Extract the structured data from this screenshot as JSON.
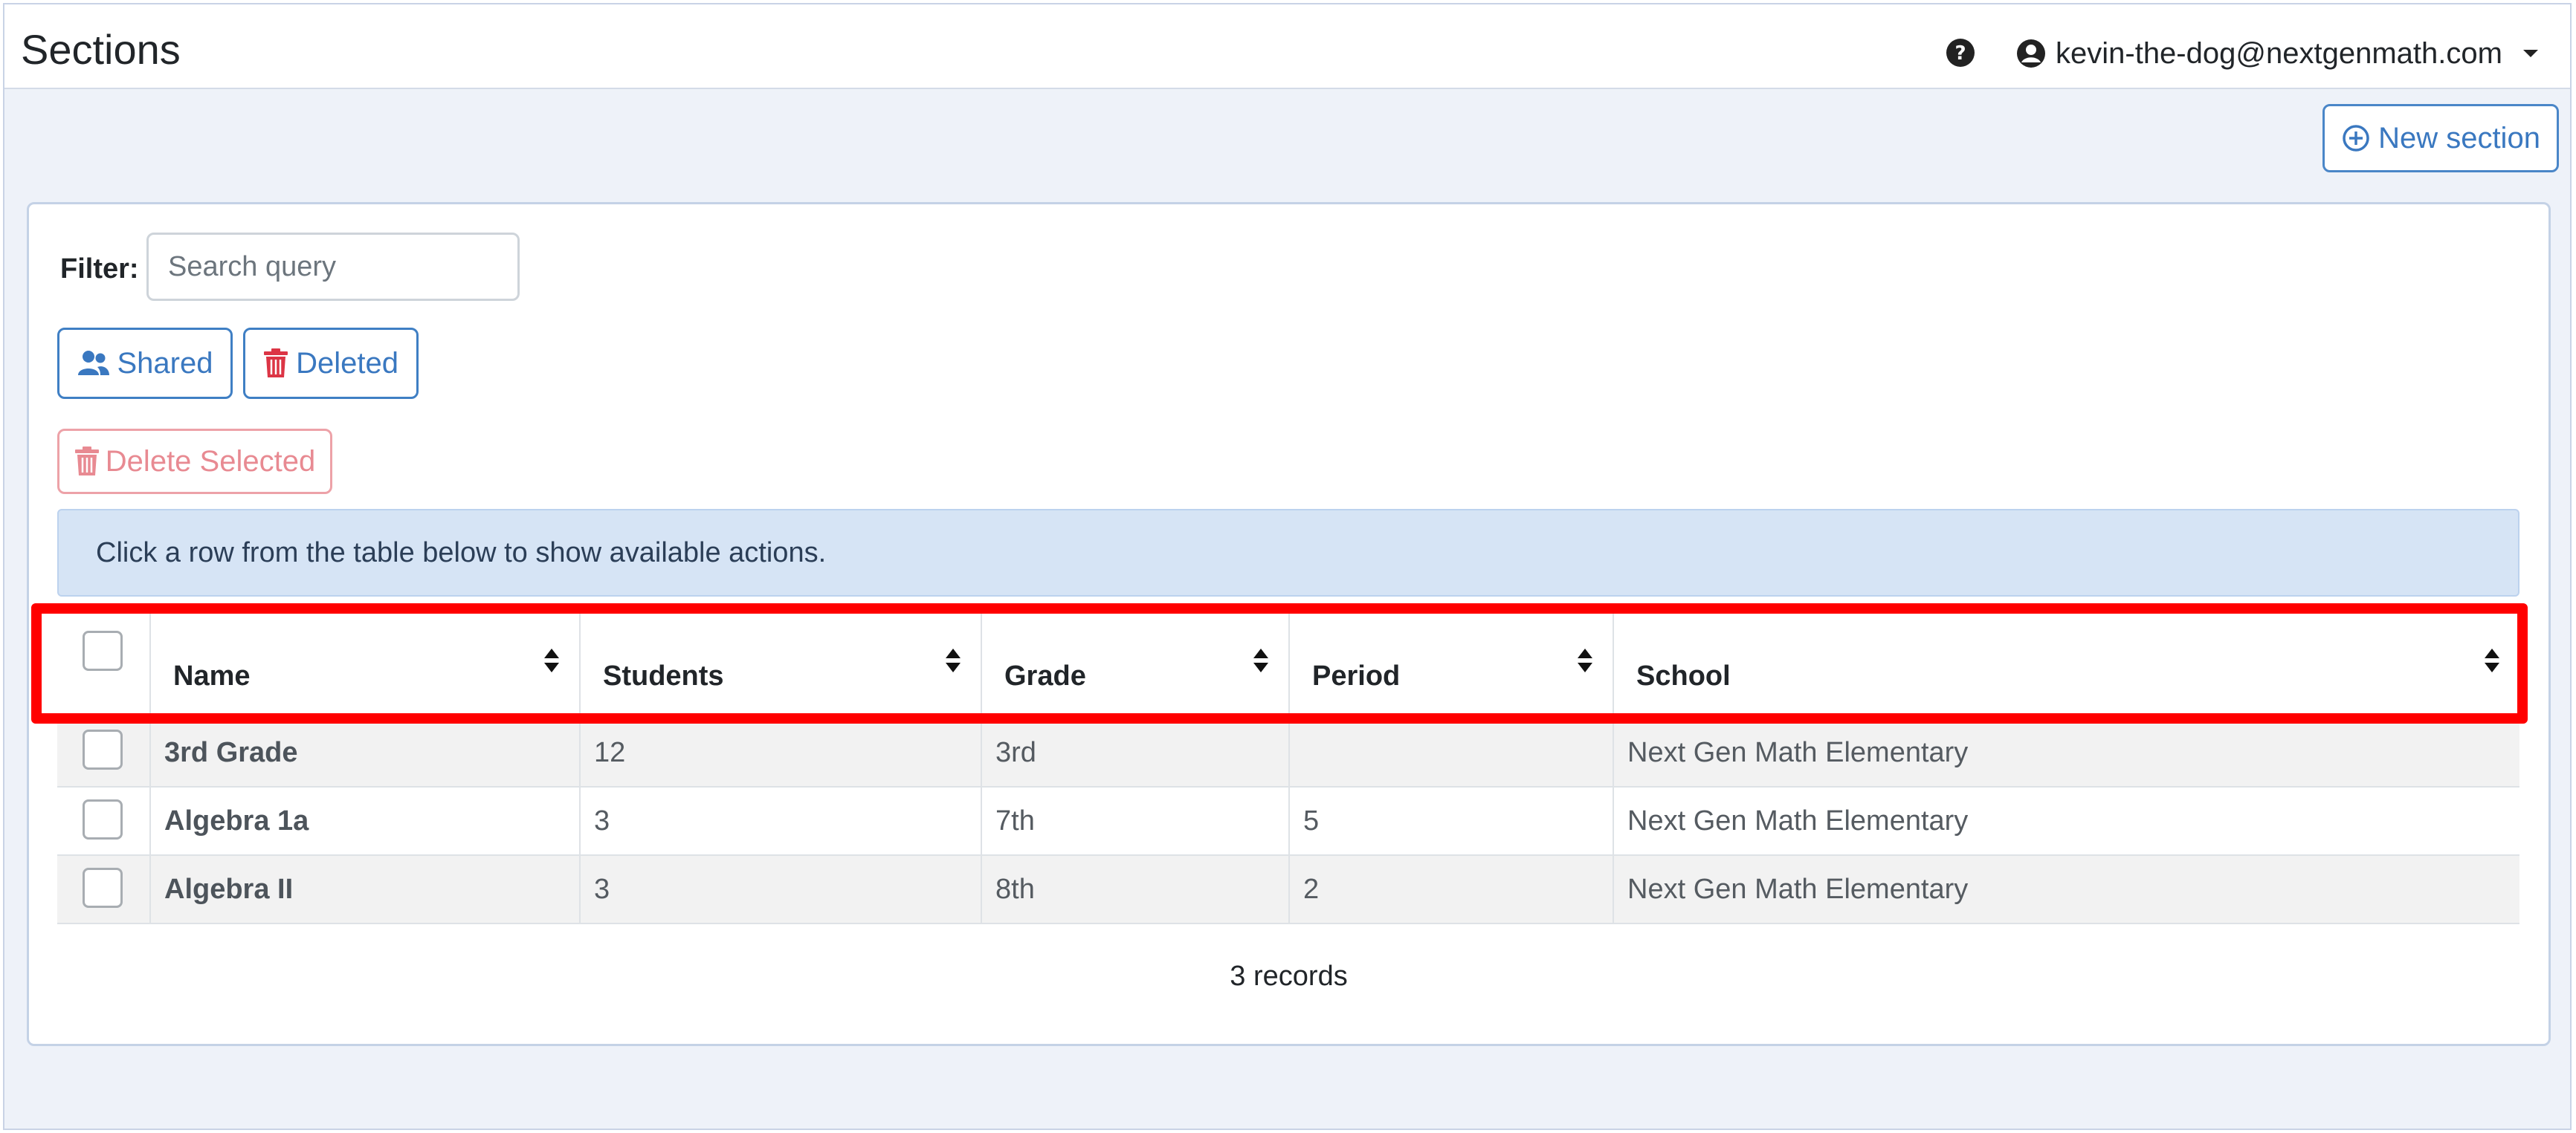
{
  "header": {
    "title": "Sections",
    "user_email": "kevin-the-dog@nextgenmath.com"
  },
  "actions": {
    "new_section_label": "New section"
  },
  "filter": {
    "label": "Filter:",
    "placeholder": "Search query",
    "value": ""
  },
  "buttons": {
    "shared_label": "Shared",
    "deleted_label": "Deleted",
    "delete_selected_label": "Delete Selected"
  },
  "alert": {
    "text": "Click a row from the table below to show available actions."
  },
  "table": {
    "columns": [
      "Name",
      "Students",
      "Grade",
      "Period",
      "School"
    ],
    "rows": [
      {
        "name": "3rd Grade",
        "students": "12",
        "grade": "3rd",
        "period": "",
        "school": "Next Gen Math Elementary"
      },
      {
        "name": "Algebra 1a",
        "students": "3",
        "grade": "7th",
        "period": "5",
        "school": "Next Gen Math Elementary"
      },
      {
        "name": "Algebra II",
        "students": "3",
        "grade": "8th",
        "period": "2",
        "school": "Next Gen Math Elementary"
      }
    ],
    "records_text": "3 records"
  },
  "colors": {
    "primary": "#3a78c0",
    "danger": "#dc3545",
    "highlight": "#ff0000",
    "alert_bg": "#d6e4f5"
  },
  "icons": [
    "question-circle-icon",
    "user-circle-icon",
    "caret-down-icon",
    "plus-circle-icon",
    "users-icon",
    "trash-icon",
    "sort-icon"
  ]
}
